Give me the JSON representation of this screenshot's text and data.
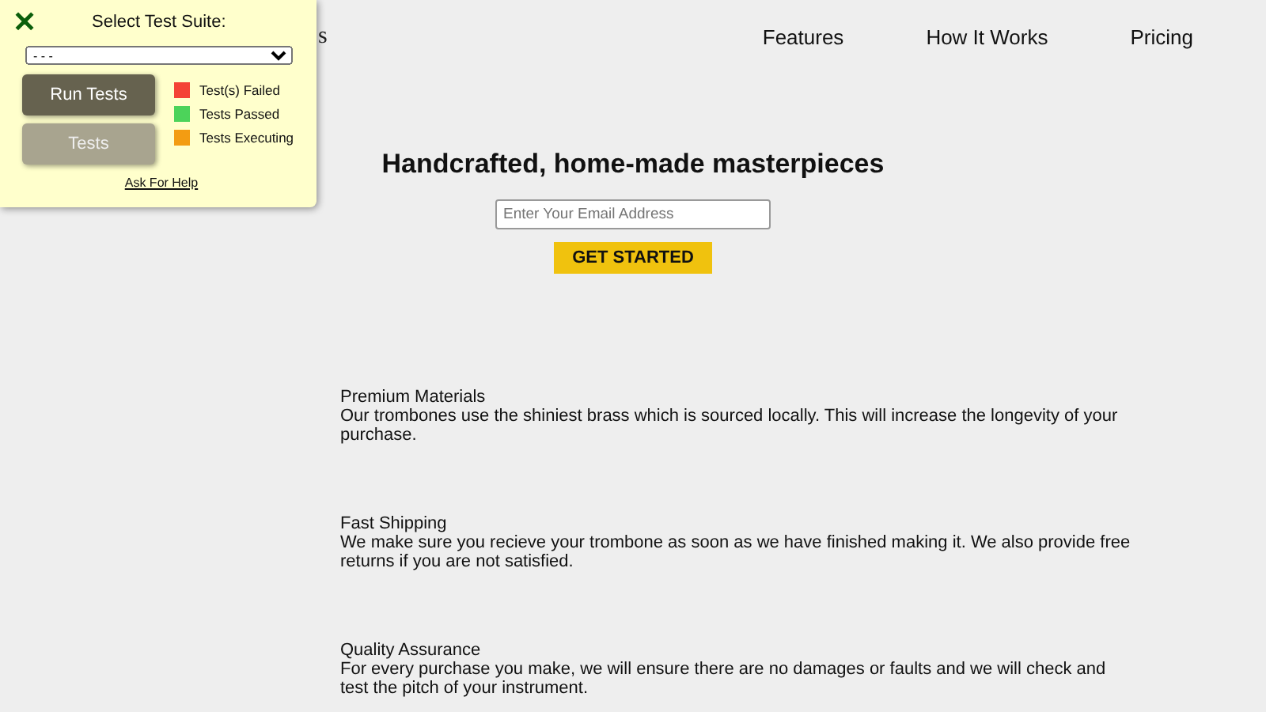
{
  "header": {
    "logo": "s",
    "nav": [
      "Features",
      "How It Works",
      "Pricing"
    ]
  },
  "hero": {
    "title": "Handcrafted, home-made masterpieces",
    "email": {
      "placeholder": "Enter Your Email Address"
    },
    "button": "GET STARTED"
  },
  "features": [
    {
      "title": "Premium Materials",
      "text": "Our trombones use the shiniest brass which is sourced locally. This will increase the longevity of your purchase."
    },
    {
      "title": "Fast Shipping",
      "text": "We make sure you recieve your trombone as soon as we have finished making it. We also provide free returns if you are not satisfied."
    },
    {
      "title": "Quality Assurance",
      "text": "For every purchase you make, we will ensure there are no damages or faults and we will check and test the pitch of your instrument."
    }
  ],
  "test_panel": {
    "close": "✕",
    "label": "Select Test Suite:",
    "suite": "- - -",
    "buttons": [
      {
        "label": "Run Tests",
        "disabled": false
      },
      {
        "label": "Tests",
        "disabled": true
      }
    ],
    "legend": [
      {
        "label": "Test(s) Failed",
        "color": "#f44336"
      },
      {
        "label": "Tests Passed",
        "color": "#4cd35a"
      },
      {
        "label": "Tests Executing",
        "color": "#f39c12"
      }
    ],
    "help": "Ask For Help"
  }
}
